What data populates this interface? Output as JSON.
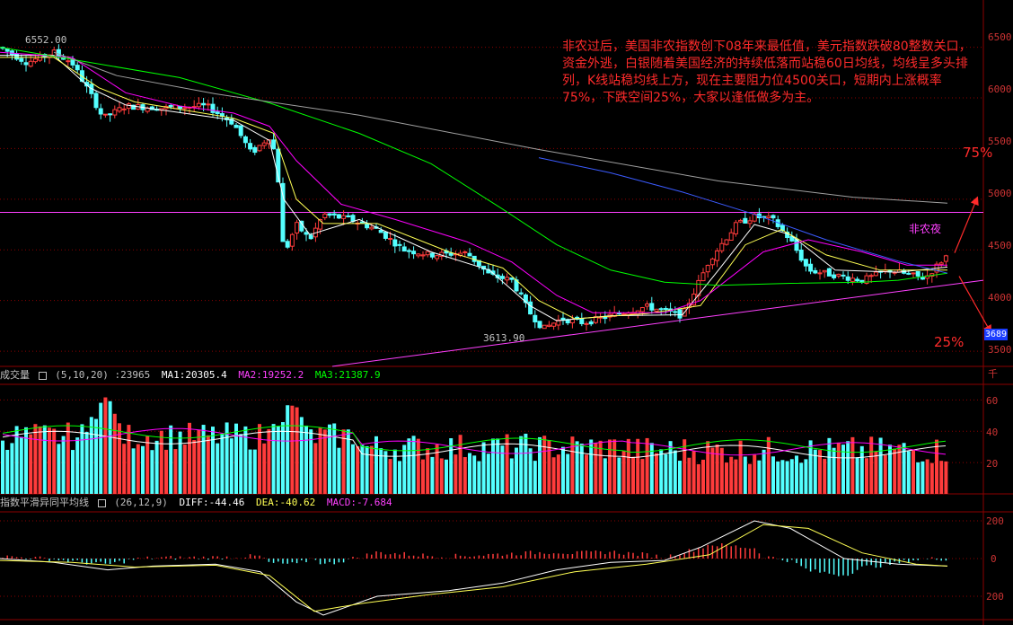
{
  "colors": {
    "up": "#ff3b3b",
    "down": "#54ffff",
    "ma_short": "#ffffff",
    "ma_mid": "#ffff54",
    "ma_20": "#ff00ff",
    "ma_60": "#00ff00",
    "ma_120": "#3b5bff",
    "ma_250": "#a0a0a0",
    "grid": "#8b0000",
    "annotation": "#ff2b2b",
    "trendline": "#ff40ff",
    "price_tag_bg": "#1a3cff"
  },
  "main_panel": {
    "annotation": "非农过后，美国非农指数创下08年来最低值，美元指数跌破80整数关口，资金外逃，白银随着美国经济的持续低落而站稳60日均线，均线呈多头排列，K线站稳均线上方，现在主要阻力位4500关口，短期内上涨概率75%，下跌空间25%，大家以逢低做多为主。",
    "label_up_prob": "75%",
    "label_down_prob": "25%",
    "label_event": "非农夜",
    "high_label": "6552.00",
    "low_label": "3613.90",
    "current_price_tag": "3689",
    "y_ticks": [
      "6500",
      "6000",
      "5500",
      "5000",
      "4500",
      "4000",
      "3500"
    ],
    "resistance_level": 4870
  },
  "volume_panel": {
    "title": "成交量",
    "params": "(5,10,20)",
    "value": ":23965",
    "ma1": "MA1:20305.4",
    "ma2": "MA2:19252.2",
    "ma3": "MA3:21387.9",
    "unit": "千",
    "y_ticks": [
      "60",
      "40",
      "20"
    ]
  },
  "macd_panel": {
    "title": "指数平滑异同平均线",
    "params": "(26,12,9)",
    "diff": "DIFF:-44.46",
    "dea": "DEA:-40.62",
    "macd": "MACD:-7.684",
    "y_ticks": [
      "200",
      "0",
      "200"
    ]
  },
  "chart_data": {
    "type": "candlestick",
    "instrument": "silver",
    "y_range": [
      3350,
      6700
    ],
    "y_ticks": [
      3500,
      4000,
      4500,
      5000,
      5500,
      6000,
      6500
    ],
    "keypoints": [
      [
        0,
        6500
      ],
      [
        30,
        6350
      ],
      [
        60,
        6450
      ],
      [
        80,
        6350
      ],
      [
        100,
        6050
      ],
      [
        115,
        5800
      ],
      [
        140,
        5920
      ],
      [
        180,
        5900
      ],
      [
        230,
        5920
      ],
      [
        260,
        5750
      ],
      [
        280,
        5450
      ],
      [
        300,
        5620
      ],
      [
        308,
        5400
      ],
      [
        316,
        4450
      ],
      [
        330,
        4750
      ],
      [
        345,
        4600
      ],
      [
        360,
        4850
      ],
      [
        390,
        4800
      ],
      [
        420,
        4700
      ],
      [
        450,
        4500
      ],
      [
        480,
        4450
      ],
      [
        520,
        4470
      ],
      [
        545,
        4250
      ],
      [
        570,
        4200
      ],
      [
        590,
        3880
      ],
      [
        605,
        3720
      ],
      [
        625,
        3820
      ],
      [
        650,
        3780
      ],
      [
        680,
        3850
      ],
      [
        720,
        3940
      ],
      [
        760,
        3850
      ],
      [
        790,
        4400
      ],
      [
        820,
        4750
      ],
      [
        840,
        4830
      ],
      [
        860,
        4800
      ],
      [
        880,
        4600
      ],
      [
        900,
        4300
      ],
      [
        930,
        4250
      ],
      [
        960,
        4200
      ],
      [
        990,
        4300
      ],
      [
        1010,
        4260
      ],
      [
        1030,
        4220
      ],
      [
        1055,
        4450
      ]
    ],
    "ma_lines": [
      {
        "name": "MA5",
        "points": [
          [
            0,
            6420
          ],
          [
            60,
            6420
          ],
          [
            100,
            6100
          ],
          [
            140,
            5930
          ],
          [
            260,
            5780
          ],
          [
            300,
            5580
          ],
          [
            316,
            5000
          ],
          [
            345,
            4650
          ],
          [
            400,
            4800
          ],
          [
            480,
            4480
          ],
          [
            545,
            4300
          ],
          [
            590,
            3950
          ],
          [
            620,
            3800
          ],
          [
            680,
            3850
          ],
          [
            760,
            3860
          ],
          [
            800,
            4300
          ],
          [
            840,
            4750
          ],
          [
            880,
            4650
          ],
          [
            930,
            4300
          ],
          [
            1000,
            4280
          ],
          [
            1055,
            4330
          ]
        ]
      },
      {
        "name": "MA10",
        "points": [
          [
            0,
            6400
          ],
          [
            60,
            6400
          ],
          [
            110,
            6100
          ],
          [
            150,
            5960
          ],
          [
            260,
            5800
          ],
          [
            305,
            5650
          ],
          [
            330,
            5000
          ],
          [
            360,
            4760
          ],
          [
            420,
            4760
          ],
          [
            500,
            4480
          ],
          [
            560,
            4320
          ],
          [
            600,
            4000
          ],
          [
            640,
            3820
          ],
          [
            720,
            3870
          ],
          [
            780,
            3950
          ],
          [
            830,
            4550
          ],
          [
            870,
            4700
          ],
          [
            920,
            4450
          ],
          [
            980,
            4300
          ],
          [
            1055,
            4300
          ]
        ]
      },
      {
        "name": "MA20",
        "points": [
          [
            0,
            6450
          ],
          [
            80,
            6400
          ],
          [
            140,
            6050
          ],
          [
            200,
            5920
          ],
          [
            260,
            5850
          ],
          [
            300,
            5720
          ],
          [
            330,
            5380
          ],
          [
            380,
            4950
          ],
          [
            440,
            4800
          ],
          [
            520,
            4580
          ],
          [
            570,
            4380
          ],
          [
            620,
            4050
          ],
          [
            660,
            3880
          ],
          [
            740,
            3880
          ],
          [
            780,
            4000
          ],
          [
            850,
            4480
          ],
          [
            900,
            4600
          ],
          [
            960,
            4480
          ],
          [
            1010,
            4350
          ],
          [
            1055,
            4350
          ]
        ]
      },
      {
        "name": "MA60",
        "points": [
          [
            0,
            6500
          ],
          [
            100,
            6350
          ],
          [
            200,
            6200
          ],
          [
            300,
            5950
          ],
          [
            400,
            5650
          ],
          [
            480,
            5350
          ],
          [
            560,
            4900
          ],
          [
            620,
            4550
          ],
          [
            680,
            4300
          ],
          [
            740,
            4180
          ],
          [
            800,
            4150
          ],
          [
            880,
            4170
          ],
          [
            960,
            4180
          ],
          [
            1000,
            4200
          ],
          [
            1055,
            4270
          ]
        ]
      },
      {
        "name": "MA120",
        "points": [
          [
            600,
            5410
          ],
          [
            680,
            5260
          ],
          [
            760,
            5070
          ],
          [
            840,
            4850
          ],
          [
            920,
            4600
          ],
          [
            1000,
            4390
          ],
          [
            1055,
            4270
          ]
        ]
      },
      {
        "name": "MA250",
        "points": [
          [
            60,
            6450
          ],
          [
            130,
            6220
          ],
          [
            240,
            6040
          ],
          [
            400,
            5830
          ],
          [
            600,
            5490
          ],
          [
            800,
            5180
          ],
          [
            950,
            5020
          ],
          [
            1055,
            4960
          ]
        ]
      }
    ],
    "trendline": [
      [
        370,
        3350
      ],
      [
        1095,
        4200
      ]
    ],
    "arrows": [
      {
        "from": [
          1063,
          4470
        ],
        "to": [
          1088,
          5010
        ]
      },
      {
        "from": [
          1068,
          4240
        ],
        "to": [
          1103,
          3690
        ]
      }
    ],
    "volume_y_range": [
      0,
      70
    ],
    "volume_ticks": [
      20,
      40,
      60
    ],
    "macd_y_range": [
      -320,
      280
    ],
    "macd_ticks": [
      200,
      0,
      -200
    ]
  }
}
